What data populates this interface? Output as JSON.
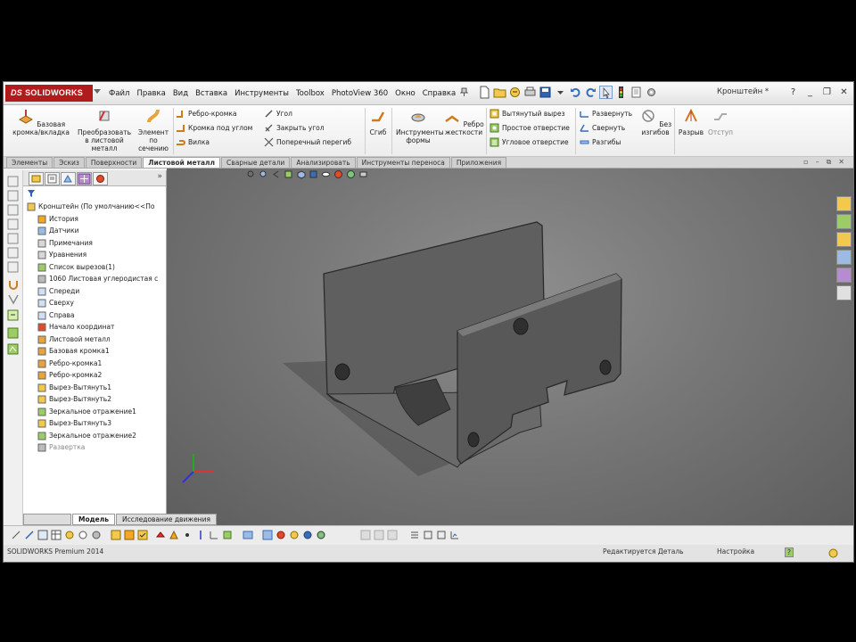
{
  "window": {
    "logo_text": "SOLIDWORKS",
    "logo_mark": "DS"
  },
  "menu": [
    "Файл",
    "Правка",
    "Вид",
    "Вставка",
    "Инструменты",
    "Toolbox",
    "PhotoView 360",
    "Окно",
    "Справка"
  ],
  "search": {
    "text": "Кронштейн *"
  },
  "window_controls": [
    "?",
    "_",
    "❐",
    "✕"
  ],
  "ribbon": {
    "big": [
      "Базовая кромка/вкладка",
      "Преобразовать в листовой металл",
      "Элемент по сечению",
      "Инструменты формы",
      "Ребро жесткости"
    ],
    "col1": [
      "Ребро-кромка",
      "Кромка под углом",
      "Вилка"
    ],
    "col2": [
      "Угол",
      "Закрыть угол",
      "Поперечный перегиб"
    ],
    "fold": "Сгиб",
    "col3": [
      "Вытянутый вырез",
      "Простое отверстие",
      "Угловое отверстие"
    ],
    "col4": [
      "Развернуть",
      "Свернуть",
      "Разгибы"
    ],
    "nobend": "Без изгибов",
    "rip": "Разрыв",
    "extra": "Отступ"
  },
  "command_tabs": [
    {
      "label": "Элементы",
      "active": false
    },
    {
      "label": "Эскиз",
      "active": false
    },
    {
      "label": "Поверхности",
      "active": false
    },
    {
      "label": "Листовой металл",
      "active": true
    },
    {
      "label": "Сварные детали",
      "active": false
    },
    {
      "label": "Анализировать",
      "active": false
    },
    {
      "label": "Инструменты переноса",
      "active": false
    },
    {
      "label": "Приложения",
      "active": false
    }
  ],
  "tree": [
    {
      "label": "Кронштейн (По умолчанию<<По",
      "level": 0
    },
    {
      "label": "История",
      "level": 1
    },
    {
      "label": "Датчики",
      "level": 1
    },
    {
      "label": "Примечания",
      "level": 1
    },
    {
      "label": "Уравнения",
      "level": 1
    },
    {
      "label": "Список вырезов(1)",
      "level": 1
    },
    {
      "label": "1060 Листовая углеродистая с",
      "level": 1
    },
    {
      "label": "Спереди",
      "level": 1
    },
    {
      "label": "Сверху",
      "level": 1
    },
    {
      "label": "Справа",
      "level": 1
    },
    {
      "label": "Начало координат",
      "level": 1
    },
    {
      "label": "Листовой металл",
      "level": 1
    },
    {
      "label": "Базовая кромка1",
      "level": 1
    },
    {
      "label": "Ребро-кромка1",
      "level": 1
    },
    {
      "label": "Ребро-кромка2",
      "level": 1
    },
    {
      "label": "Вырез-Вытянуть1",
      "level": 1
    },
    {
      "label": "Вырез-Вытянуть2",
      "level": 1
    },
    {
      "label": "Зеркальное отражение1",
      "level": 1
    },
    {
      "label": "Вырез-Вытянуть3",
      "level": 1
    },
    {
      "label": "Зеркальное отражение2",
      "level": 1
    },
    {
      "label": "Развертка",
      "level": 1,
      "dim": true
    }
  ],
  "model_tabs": [
    {
      "label": "",
      "active": false
    },
    {
      "label": "Модель",
      "active": true
    },
    {
      "label": "Исследование движения",
      "active": false
    }
  ],
  "status": {
    "app": "SOLIDWORKS Premium 2014",
    "mode": "Редактируется Деталь",
    "units": "Настройка",
    "help": "?"
  },
  "colors": {
    "logo_bg": "#b01c1c",
    "viewport_bg": "#777777",
    "part": "#5a5a5a"
  }
}
